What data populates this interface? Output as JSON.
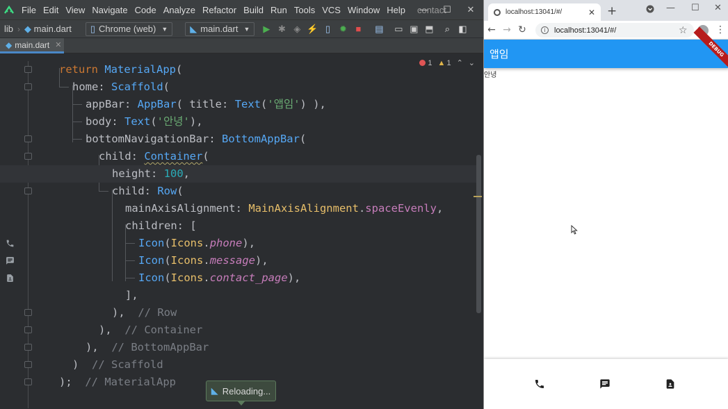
{
  "ide": {
    "menu": [
      "File",
      "Edit",
      "View",
      "Navigate",
      "Code",
      "Analyze",
      "Refactor",
      "Build",
      "Run",
      "Tools",
      "VCS",
      "Window",
      "Help"
    ],
    "window_title": "contact",
    "window_controls": [
      "—",
      "☐",
      "✕"
    ],
    "breadcrumb": [
      "lib",
      "main.dart"
    ],
    "device_selector": "Chrome (web)",
    "run_config": "main.dart",
    "tab": "main.dart",
    "inspections": {
      "errors": "1",
      "warnings": "1"
    },
    "code": {
      "l1": [
        "return",
        " ",
        "MaterialApp",
        "("
      ],
      "l2": [
        "home",
        ": ",
        "Scaffold",
        "("
      ],
      "l3": [
        "appBar",
        ": ",
        "AppBar",
        "( ",
        "title",
        ": ",
        "Text",
        "(",
        "'앱임'",
        ") ),"
      ],
      "l4": [
        "body",
        ": ",
        "Text",
        "(",
        "'안녕'",
        "),"
      ],
      "l5": [
        "bottomNavigationBar",
        ": ",
        "BottomAppBar",
        "("
      ],
      "l6": [
        "child",
        ": ",
        "Container",
        "("
      ],
      "l7": [
        "height",
        ": ",
        "100",
        ","
      ],
      "l8": [
        "child",
        ": ",
        "Row",
        "("
      ],
      "l9": [
        "mainAxisAlignment",
        ": ",
        "MainAxisAlignment",
        ".",
        "spaceEvenly",
        ","
      ],
      "l10": [
        "children",
        ": ["
      ],
      "l11": [
        "Icon",
        "(",
        "Icons",
        ".",
        "phone",
        "),"
      ],
      "l12": [
        "Icon",
        "(",
        "Icons",
        ".",
        "message",
        "),"
      ],
      "l13": [
        "Icon",
        "(",
        "Icons",
        ".",
        "contact_page",
        "),"
      ],
      "l14": [
        "],"
      ],
      "l15": [
        "),",
        "  // Row"
      ],
      "l16": [
        "),",
        "  // Container"
      ],
      "l17": [
        "),",
        "  // BottomAppBar"
      ],
      "l18": [
        ")",
        "  // Scaffold"
      ],
      "l19": [
        ");",
        "  // MaterialApp"
      ]
    },
    "toast": "Reloading..."
  },
  "browser": {
    "tab_title": "localhost:13041/#/",
    "url": "localhost:13041/#/",
    "window_controls": [
      "—",
      "☐",
      "✕"
    ],
    "app": {
      "appbar_title": "앱임",
      "debug_label": "DEBUG",
      "body_text": "안녕",
      "appbar_color": "#2196f3"
    }
  }
}
